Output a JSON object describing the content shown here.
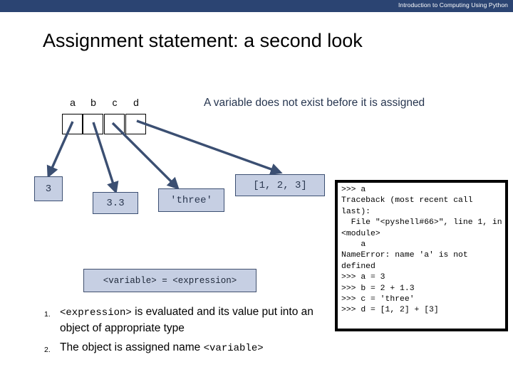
{
  "header": {
    "course_title": "Introduction to Computing Using Python"
  },
  "slide": {
    "title": "Assignment statement: a second look",
    "callout": "A variable does not exist before it is assigned"
  },
  "variables": [
    {
      "name": "a"
    },
    {
      "name": "b"
    },
    {
      "name": "c"
    },
    {
      "name": "d"
    }
  ],
  "objects": [
    {
      "id": "a",
      "value": "3"
    },
    {
      "id": "b",
      "value": "3.3"
    },
    {
      "id": "c",
      "value": "'three'"
    },
    {
      "id": "d",
      "value": "[1, 2, 3]"
    }
  ],
  "syntax": {
    "template": "<variable> = <expression>"
  },
  "steps": [
    {
      "number": "1.",
      "code_lead": "<expression>",
      "text": " is evaluated and its value put into an object of appropriate type"
    },
    {
      "number": "2.",
      "text_lead": "The object is assigned name ",
      "code_tail": "<variable>"
    }
  ],
  "console": {
    "text": ">>> a\nTraceback (most recent call last):\n  File \"<pyshell#66>\", line 1, in <module>\n    a\nNameError: name 'a' is not defined\n>>> a = 3\n>>> b = 2 + 1.3\n>>> c = 'three'\n>>> d = [1, 2] + [3]"
  },
  "colors": {
    "header_bar": "#2b4472",
    "arrow": "#3b4f72",
    "object_fill": "#c6cfe3",
    "object_border": "#3c4f72",
    "callout_text": "#26354f"
  }
}
